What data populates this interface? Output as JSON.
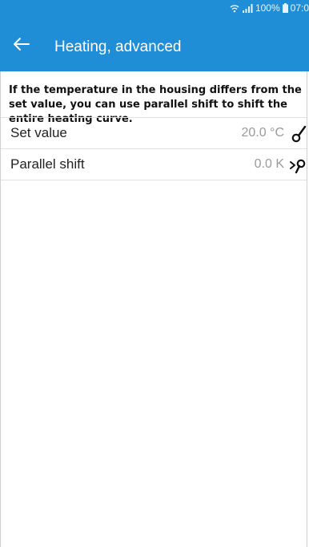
{
  "status_bar": {
    "battery": "100%",
    "time": "07:0"
  },
  "app_bar": {
    "back_icon": "arrow-left-icon",
    "title": "Heating, advanced"
  },
  "description_lines": [
    "If the temperature in the housing differs from the",
    "set value, you can use parallel shift to shift the",
    "entire heating curve."
  ],
  "settings": [
    {
      "label": "Set value",
      "value": "20.0 °C",
      "icon": "edit-icon"
    },
    {
      "label": "Parallel shift",
      "value": "0.0 K",
      "icon": "edit-icon"
    }
  ],
  "colors": {
    "app_bar": "#1f8ed6",
    "value_text": "#9a9a9a"
  }
}
